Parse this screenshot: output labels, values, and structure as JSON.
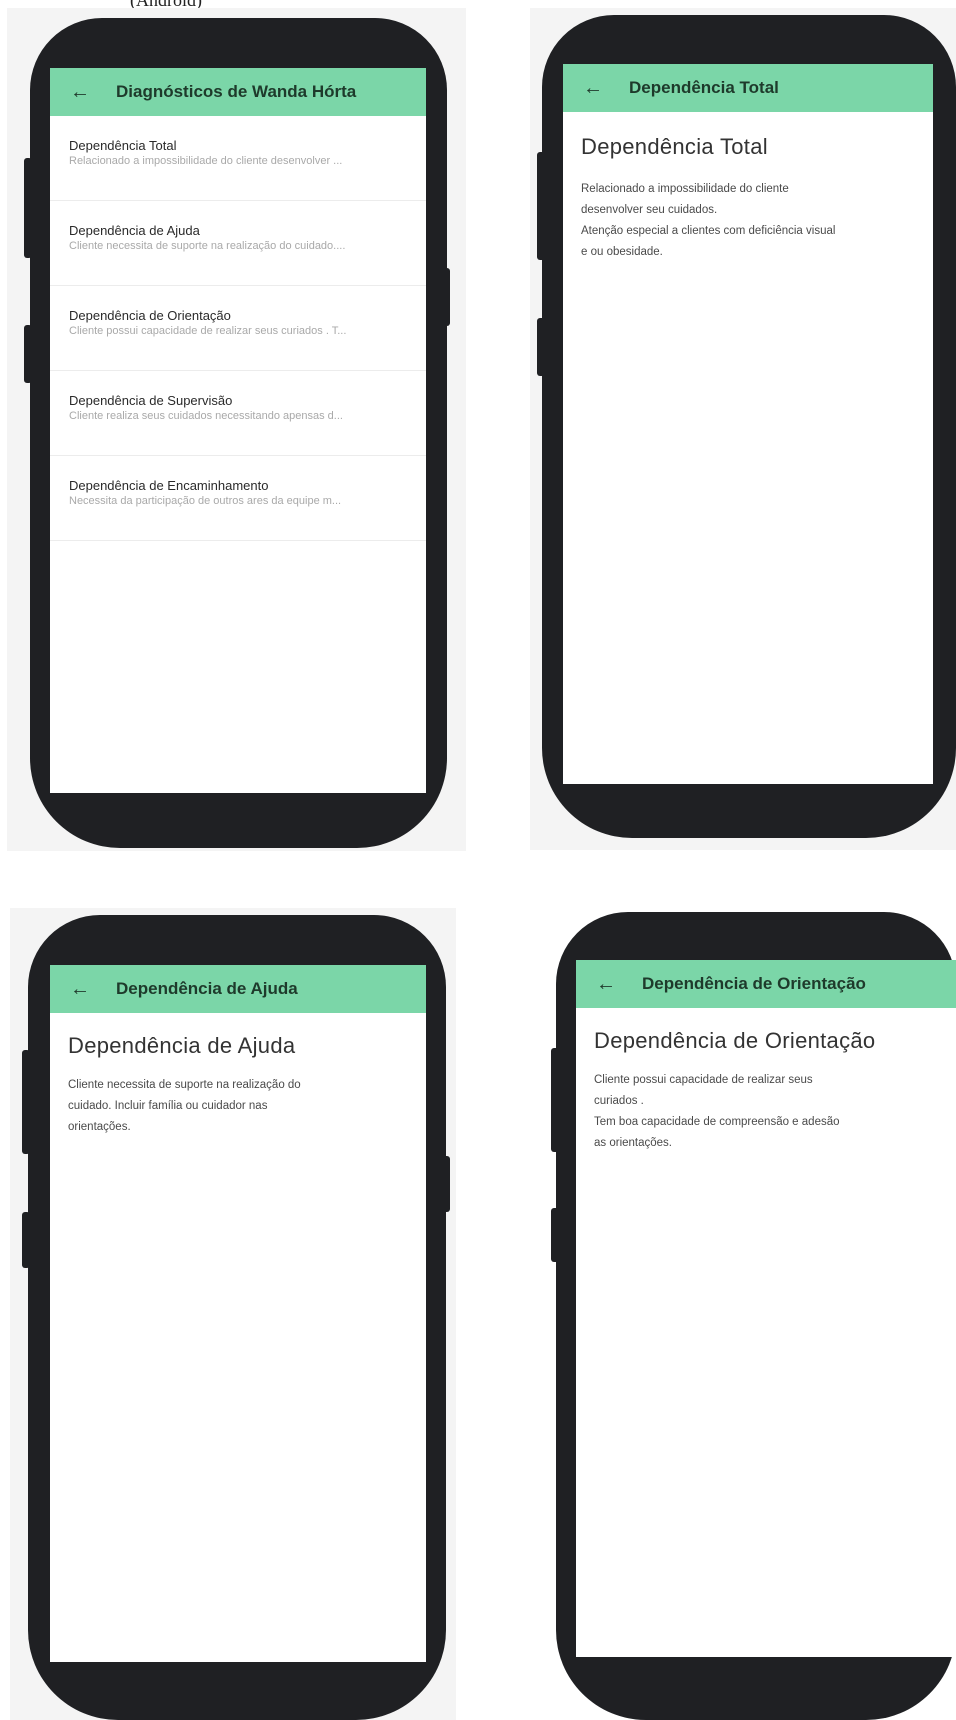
{
  "caption_fragment": "(Android)",
  "list_screen": {
    "title": "Diagnósticos de Wanda Hórta",
    "items": [
      {
        "title": "Dependência Total",
        "subtitle": "Relacionado a impossibilidade do cliente desenvolver ..."
      },
      {
        "title": "Dependência de Ajuda",
        "subtitle": "Cliente necessita de suporte na realização do cuidado...."
      },
      {
        "title": "Dependência de Orientação",
        "subtitle": "Cliente possui capacidade de realizar seus curiados . T..."
      },
      {
        "title": "Dependência de Supervisão",
        "subtitle": "Cliente realiza seus cuidados necessitando apensas d..."
      },
      {
        "title": "Dependência de Encaminhamento",
        "subtitle": "Necessita da participação de outros ares da equipe m..."
      }
    ]
  },
  "detail_total": {
    "appbar_title": "Dependência Total",
    "heading": "Dependência Total",
    "body": "Relacionado a impossibilidade do cliente\ndesenvolver seu cuidados.\nAtenção especial a clientes com deficiência visual\ne ou obesidade."
  },
  "detail_ajuda": {
    "appbar_title": "Dependência de Ajuda",
    "heading": "Dependência de Ajuda",
    "body": "Cliente necessita de suporte na realização do\ncuidado. Incluir família ou cuidador nas\norientações."
  },
  "detail_orientacao": {
    "appbar_title": "Dependência de Orientação",
    "heading": "Dependência de Orientação",
    "body": "Cliente possui capacidade de realizar seus\ncuriados .\nTem boa capacidade de compreensão e adesão\nas orientações."
  },
  "icons": {
    "back": "arrow-left-icon"
  },
  "colors": {
    "appbar": "#7bd6a8",
    "phone_body": "#1f2023",
    "panel_bg": "#f4f4f4"
  }
}
